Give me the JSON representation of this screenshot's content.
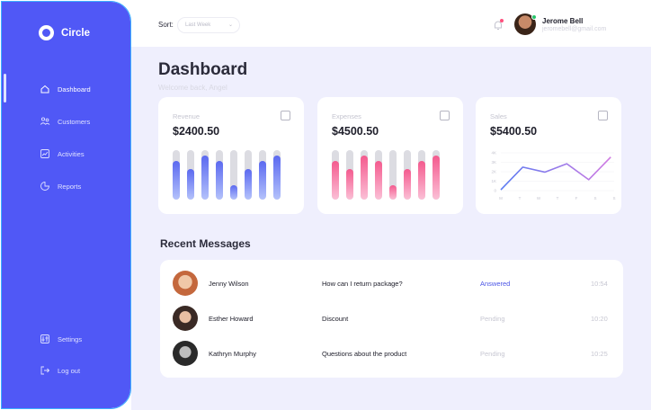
{
  "brand": {
    "name": "Circle"
  },
  "sidebar": {
    "items": [
      {
        "label": "Dashboard",
        "icon": "home-icon"
      },
      {
        "label": "Customers",
        "icon": "people-icon"
      },
      {
        "label": "Activities",
        "icon": "activity-chart-icon"
      },
      {
        "label": "Reports",
        "icon": "pie-chart-icon"
      }
    ],
    "bottom_items": [
      {
        "label": "Settings",
        "icon": "settings-icon"
      },
      {
        "label": "Log out",
        "icon": "logout-icon"
      }
    ]
  },
  "topbar": {
    "sort_label": "Sort:",
    "sort_value": "Last Week",
    "user_name": "Jerome Bell",
    "user_email": "jeromebell@gmail.com"
  },
  "header": {
    "title": "Dashboard",
    "subtitle": "Welcome back, Angel"
  },
  "cards": [
    {
      "label": "Revenue",
      "value": "$2400.50",
      "icon": "growth-icon",
      "color": "#5b69f0"
    },
    {
      "label": "Expenses",
      "value": "$4500.50",
      "icon": "decline-icon",
      "color": "#f45a8e"
    },
    {
      "label": "Sales",
      "value": "$5400.50",
      "icon": "bar-chart-icon",
      "color": "#b784e8"
    }
  ],
  "chart_data": [
    {
      "type": "bar",
      "title": "",
      "values": [
        0.78,
        0.61,
        0.89,
        0.78,
        0.29,
        0.62,
        0.78,
        0.89
      ],
      "ylim": [
        0,
        1
      ]
    },
    {
      "type": "bar",
      "title": "",
      "values": [
        0.78,
        0.62,
        0.89,
        0.78,
        0.29,
        0.62,
        0.78,
        0.89
      ],
      "ylim": [
        0,
        1
      ]
    },
    {
      "type": "line",
      "title": "",
      "categories": [
        "M",
        "T",
        "W",
        "T",
        "F",
        "S",
        "S"
      ],
      "yticks": [
        "4K",
        "3K",
        "2K",
        "1K",
        "0"
      ],
      "values": [
        0.1,
        2.8,
        2.2,
        3.2,
        1.3,
        4.0
      ],
      "ylim": [
        0,
        4.5
      ]
    }
  ],
  "messages": {
    "title": "Recent Messages",
    "rows": [
      {
        "name": "Jenny Wilson",
        "text": "How can I return package?",
        "status": "Answered",
        "time": "10:54"
      },
      {
        "name": "Esther Howard",
        "text": "Discount",
        "status": "Pending",
        "time": "10:20"
      },
      {
        "name": "Kathryn Murphy",
        "text": "Questions about the product",
        "status": "Pending",
        "time": "10:25"
      }
    ]
  }
}
